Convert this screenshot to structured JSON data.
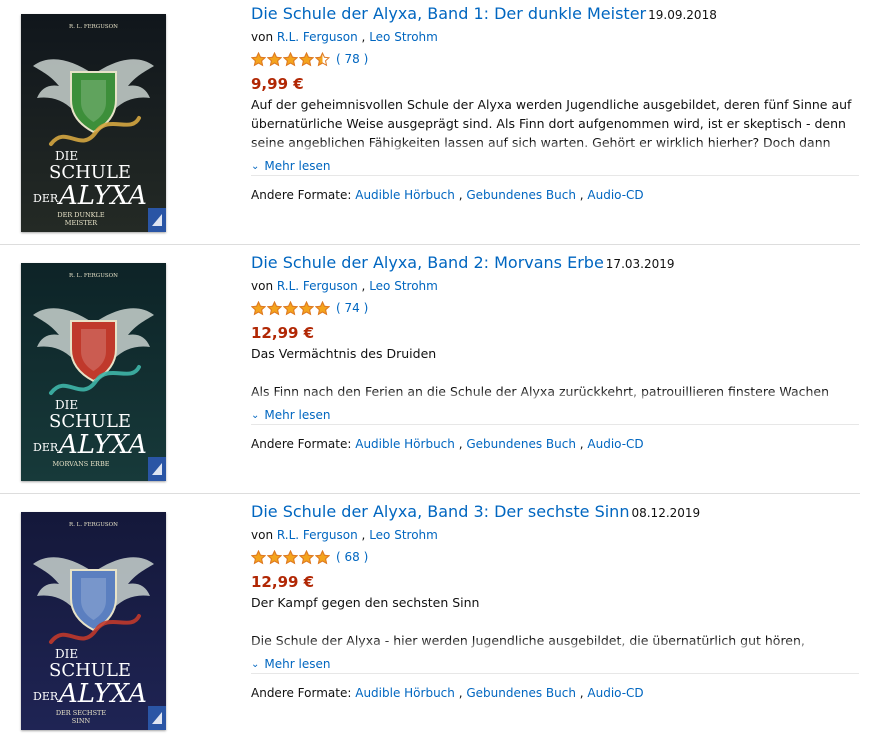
{
  "books": [
    {
      "title": "Die Schule der Alyxa, Band 1: Der dunkle Meister",
      "date": "19.09.2018",
      "by_prefix": "von",
      "authors": [
        "R.L. Ferguson",
        "Leo Strohm"
      ],
      "author_sep": ",",
      "rating_count": "( 78 )",
      "stars": 4.5,
      "price": "9,99 €",
      "subtitle": "",
      "description": "Auf der geheimnisvollen Schule der Alyxa werden Jugendliche ausgebildet, deren fünf Sinne auf übernatürliche Weise ausgeprägt sind. Als Finn dort aufgenommen wird, ist er skeptisch - denn seine angeblichen Fähigkeiten lassen auf sich warten. Gehört er wirklich hierher? Doch dann entdeckt Finn,",
      "more_label": "Mehr lesen",
      "formats_label": "Andere Formate:",
      "formats": [
        "Audible Hörbuch",
        "Gebundenes Buch",
        "Audio-CD"
      ],
      "cover": {
        "author": "R. L. FERGUSON",
        "line1": "DIE",
        "line2": "SCHULE",
        "line3": "DER",
        "line4": "ALYXA",
        "subtitle1": "DER DUNKLE",
        "subtitle2": "MEISTER",
        "bg_top": "#10161c",
        "bg_bottom": "#242a25",
        "crest": "#3d8f3a",
        "accent": "#d5a640"
      }
    },
    {
      "title": "Die Schule der Alyxa, Band 2: Morvans Erbe",
      "date": "17.03.2019",
      "by_prefix": "von",
      "authors": [
        "R.L. Ferguson",
        "Leo Strohm"
      ],
      "author_sep": ",",
      "rating_count": "( 74 )",
      "stars": 5,
      "price": "12,99 €",
      "subtitle": "Das Vermächtnis des Druiden",
      "description": "Als Finn nach den Ferien an die Schule der Alyxa zurückkehrt, patrouillieren finstere Wachen durch",
      "more_label": "Mehr lesen",
      "formats_label": "Andere Formate:",
      "formats": [
        "Audible Hörbuch",
        "Gebundenes Buch",
        "Audio-CD"
      ],
      "cover": {
        "author": "R. L. FERGUSON",
        "line1": "DIE",
        "line2": "SCHULE",
        "line3": "DER",
        "line4": "ALYXA",
        "subtitle1": "MORVANS ERBE",
        "subtitle2": "",
        "bg_top": "#0d2327",
        "bg_bottom": "#173a3a",
        "crest": "#c0392b",
        "accent": "#3fb6a8"
      }
    },
    {
      "title": "Die Schule der Alyxa, Band 3: Der sechste Sinn",
      "date": "08.12.2019",
      "by_prefix": "von",
      "authors": [
        "R.L. Ferguson",
        "Leo Strohm"
      ],
      "author_sep": ",",
      "rating_count": "( 68 )",
      "stars": 5,
      "price": "12,99 €",
      "subtitle": "Der Kampf gegen den sechsten Sinn",
      "description": "Die Schule der Alyxa - hier werden Jugendliche ausgebildet, die übernatürlich gut hören, riechen,",
      "more_label": "Mehr lesen",
      "formats_label": "Andere Formate:",
      "formats": [
        "Audible Hörbuch",
        "Gebundenes Buch",
        "Audio-CD"
      ],
      "cover": {
        "author": "R. L. FERGUSON",
        "line1": "DIE",
        "line2": "SCHULE",
        "line3": "DER",
        "line4": "ALYXA",
        "subtitle1": "DER SECHSTE",
        "subtitle2": "SINN",
        "bg_top": "#14183a",
        "bg_bottom": "#1f2454",
        "crest": "#5b7fc0",
        "accent": "#c0392b"
      }
    }
  ],
  "colors": {
    "link": "#0066c0",
    "price": "#b12704",
    "star": "#f4a41d",
    "star_outline": "#de7921"
  }
}
